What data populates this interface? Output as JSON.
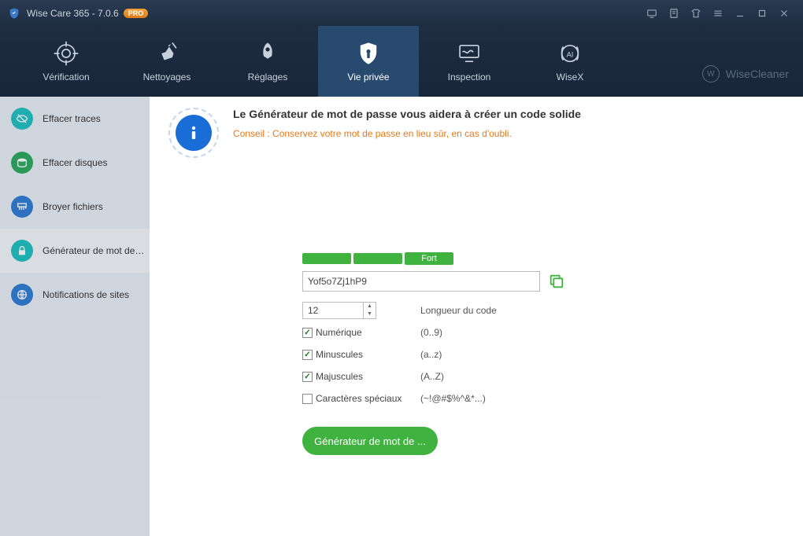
{
  "titlebar": {
    "app_name": "Wise Care 365 - 7.0.6",
    "badge": "PRO"
  },
  "tabs": {
    "verification": "Vérification",
    "nettoyages": "Nettoyages",
    "reglages": "Réglages",
    "vie_privee": "Vie privée",
    "inspection": "Inspection",
    "wisex": "WiseX"
  },
  "brand": "WiseCleaner",
  "sidebar": {
    "effacer_traces": "Effacer traces",
    "effacer_disques": "Effacer disques",
    "broyer_fichiers": "Broyer fichiers",
    "generateur": "Générateur de mot de p...",
    "notifications": "Notifications de sites"
  },
  "intro": {
    "heading": "Le Générateur de mot de passe vous aidera à créer un code solide",
    "tip": "Conseil : Conservez votre mot de passe en lieu sûr, en cas d'oubli."
  },
  "pwd": {
    "strength_label": "Fort",
    "value": "Yof5o7Zj1hP9",
    "length": "12",
    "length_label": "Longueur du code",
    "numeric_label": "Numérique",
    "numeric_hint": "(0..9)",
    "lower_label": "Minuscules",
    "lower_hint": "(a..z)",
    "upper_label": "Majuscules",
    "upper_hint": "(A..Z)",
    "special_label": "Caractères spéciaux",
    "special_hint": "(~!@#$%^&*...)",
    "generate_btn": "Générateur de mot de ..."
  }
}
